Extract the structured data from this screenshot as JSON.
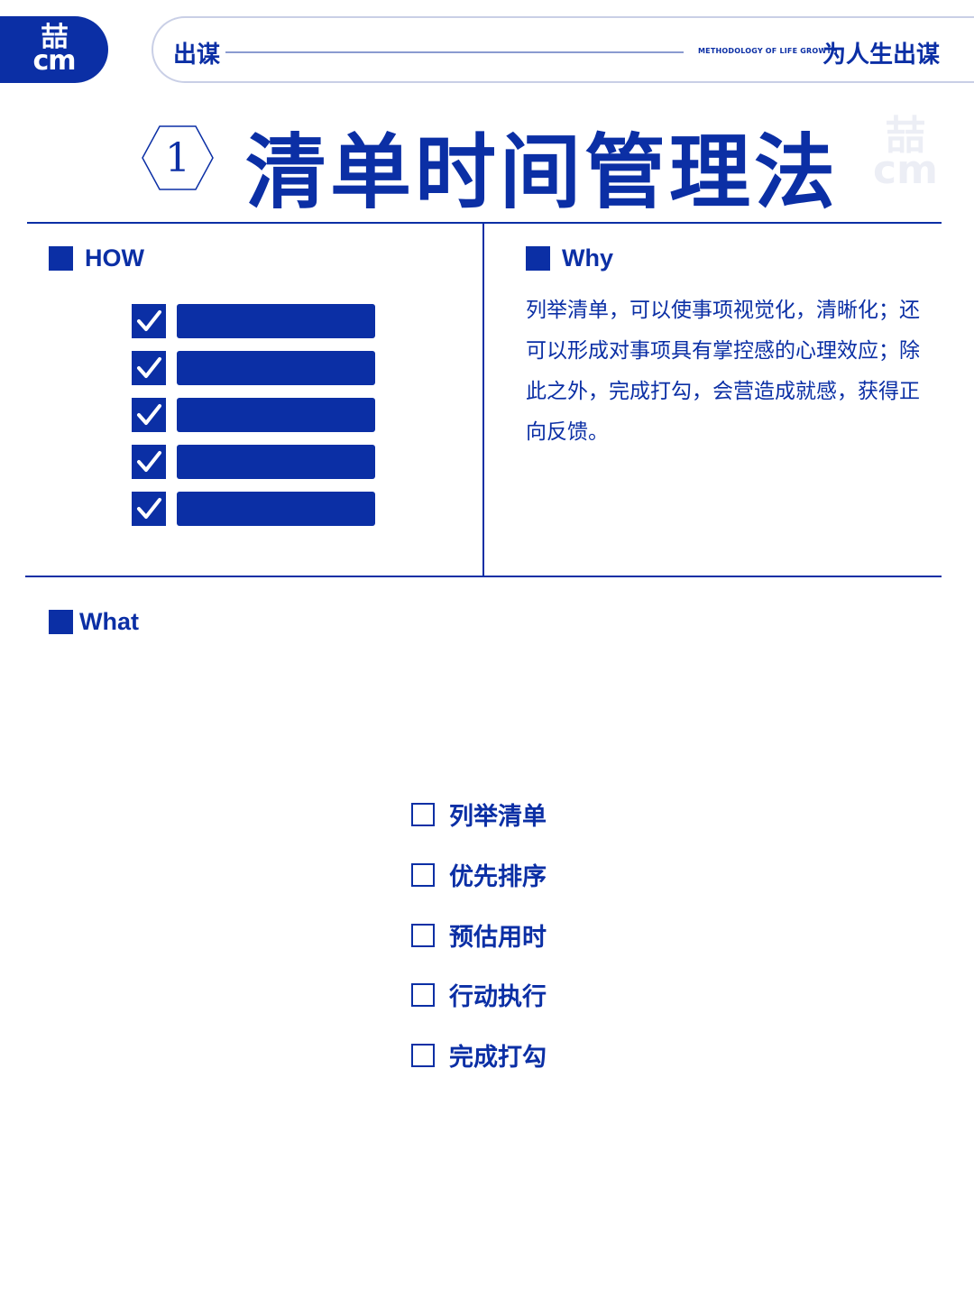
{
  "header": {
    "logo_top": "喆",
    "logo_bottom": "cm",
    "brand": "出谋",
    "tagline_small": "METHODOLOGY OF LIFE GROWTH",
    "slogan": "为人生出谋"
  },
  "title": {
    "number": "1",
    "text": "清单时间管理法",
    "watermark_top": "喆",
    "watermark_bottom": "cm"
  },
  "how": {
    "label": "HOW",
    "rows": 5
  },
  "why": {
    "label": "Why",
    "text": "列举清单，可以使事项视觉化，清晰化；还可以形成对事项具有掌控感的心理效应；除此之外，完成打勾，会营造成就感，获得正向反馈。"
  },
  "what": {
    "label": "What",
    "items": [
      "列举清单",
      "优先排序",
      "预估用时",
      "行动执行",
      "完成打勾"
    ]
  },
  "colors": {
    "primary": "#0b2fa5",
    "rule": "#8a9bd0"
  }
}
